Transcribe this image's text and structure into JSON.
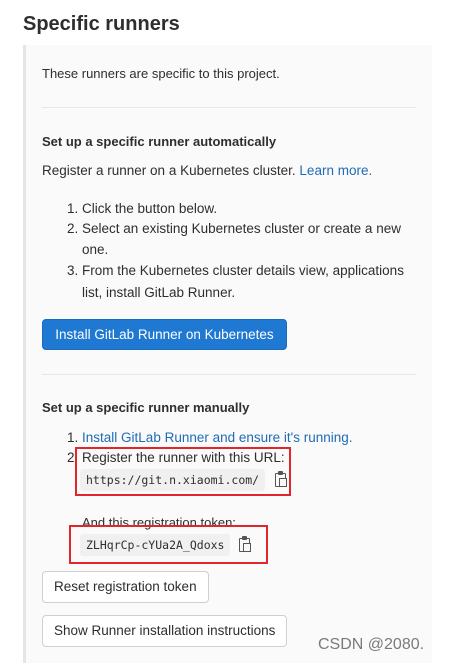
{
  "page_title": "Specific runners",
  "intro": "These runners are specific to this project.",
  "auto": {
    "heading": "Set up a specific runner automatically",
    "desc": "Register a runner on a Kubernetes cluster.",
    "learn_more": "Learn more.",
    "steps": [
      {
        "num": "1.",
        "line1": "Click the button below.",
        "line2": ""
      },
      {
        "num": "2.",
        "line1": "Select an existing Kubernetes cluster or create a new",
        "line2": "one."
      },
      {
        "num": "3.",
        "line1": "From the Kubernetes cluster details view, applications",
        "line2": "list, install GitLab Runner."
      }
    ],
    "install_button": "Install GitLab Runner on Kubernetes"
  },
  "manual": {
    "heading": "Set up a specific runner manually",
    "step1_num": "1.",
    "step1_link": "Install GitLab Runner and ensure it's running.",
    "step2_num": "2.",
    "step2_text": "Register the runner with this URL:",
    "url": "https://git.n.xiaomi.com/",
    "token_label": "And this registration token:",
    "token": "ZLHqrCp-cYUa2A_Qdoxs",
    "reset_button": "Reset registration token",
    "show_button": "Show Runner installation instructions"
  },
  "watermark": "CSDN @2080.",
  "colors": {
    "link": "#1f6bb5",
    "primary_button": "#1f78d1",
    "highlight_box": "#e0262b"
  }
}
